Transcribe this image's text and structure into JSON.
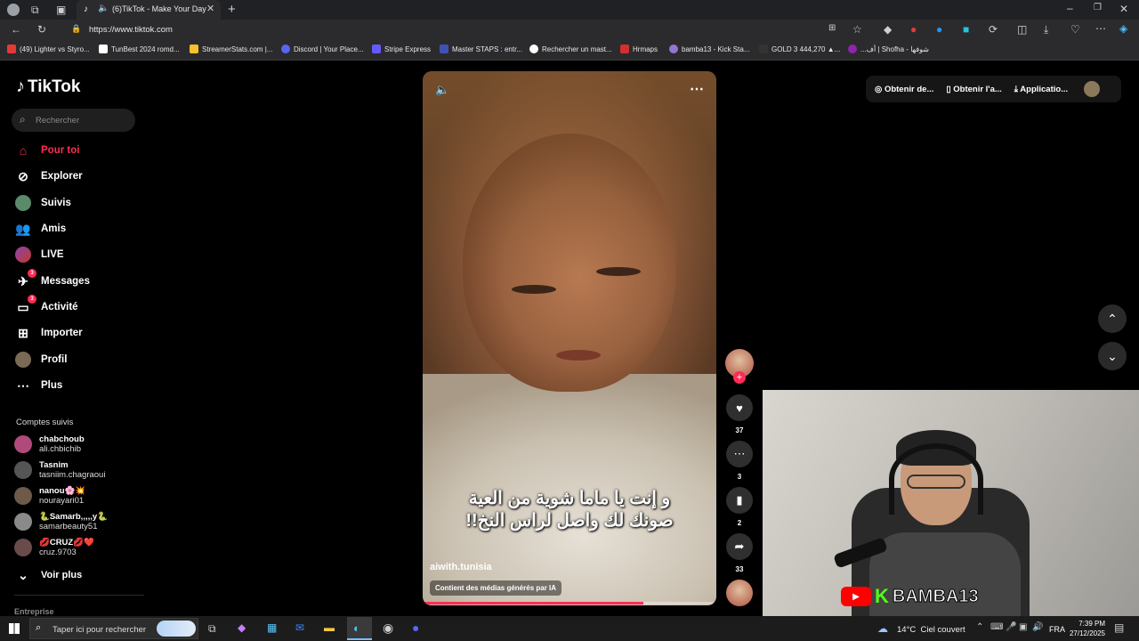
{
  "browser": {
    "tab_title": "(6)TikTok - Make Your Day",
    "url": "https://www.tiktok.com",
    "bookmarks": [
      "(49) Lighter vs Styro...",
      "TunBest 2024 romd...",
      "StreamerStats.com |...",
      "Discord | Your Place...",
      "Stripe Express",
      "Master STAPS : entr...",
      "Rechercher un mast...",
      "Hrmaps",
      "bamba13 - Kick Sta...",
      "GOLD 3 444,270 ▲...",
      "...أف | Shofha - شوفها"
    ]
  },
  "tiktok": {
    "logo": "TikTok",
    "search_placeholder": "Rechercher",
    "nav": [
      {
        "label": "Pour toi",
        "icon": "home-icon"
      },
      {
        "label": "Explorer",
        "icon": "compass-icon"
      },
      {
        "label": "Suivis",
        "icon": "following-icon"
      },
      {
        "label": "Amis",
        "icon": "friends-icon"
      },
      {
        "label": "LIVE",
        "icon": "live-icon"
      },
      {
        "label": "Messages",
        "icon": "messages-icon",
        "badge": "3"
      },
      {
        "label": "Activité",
        "icon": "activity-icon",
        "badge": "3"
      },
      {
        "label": "Importer",
        "icon": "upload-icon"
      },
      {
        "label": "Profil",
        "icon": "profile-icon"
      },
      {
        "label": "Plus",
        "icon": "more-icon"
      }
    ],
    "followed_heading": "Comptes suivis",
    "followed": [
      {
        "name": "chabchoub",
        "handle": "ali.chbichib"
      },
      {
        "name": "Tasnim",
        "handle": "tasniim.chagraoui"
      },
      {
        "name": "nanou🌸💥",
        "handle": "nourayari01"
      },
      {
        "name": "🐍Samarb,,,,,y🐍",
        "handle": "samarbeauty51"
      },
      {
        "name": "💋CRUZ💋❤️",
        "handle": "cruz.9703"
      }
    ],
    "see_more": "Voir plus",
    "footer_label": "Entreprise",
    "top_actions": [
      "Obtenir de...",
      "Obtenir l'a...",
      "Applicatio..."
    ],
    "video": {
      "caption_line1": "و إنت يا ماما شوية من العية",
      "caption_line2": "صونك لك واصل لراس النخ!!",
      "author": "aiwith.tunisia",
      "ai_label": "Contient des médias générés par IA",
      "progress": 0.75
    },
    "actions": {
      "likes": "37",
      "comments": "3",
      "saves": "2",
      "shares": "33"
    }
  },
  "webcam": {
    "overlay_label": "BAMBA13"
  },
  "taskbar": {
    "search_placeholder": "Taper ici pour rechercher",
    "weather": "14°C  Ciel couvert",
    "language": "FRA",
    "time": "7:39 PM",
    "date": "27/12/2025"
  }
}
